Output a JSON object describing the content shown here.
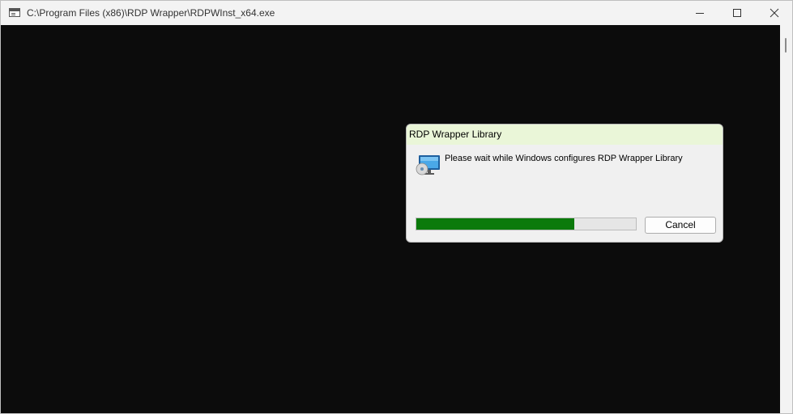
{
  "window": {
    "title": "C:\\Program Files (x86)\\RDP Wrapper\\RDPWInst_x64.exe",
    "controls": {
      "minimize_icon": "minimize-icon",
      "maximize_icon": "maximize-icon",
      "close_icon": "close-icon"
    }
  },
  "dialog": {
    "title": "RDP Wrapper Library",
    "message": "Please wait while Windows configures RDP Wrapper Library",
    "icon": "setup-computer-icon",
    "progress": 0.72,
    "cancel_label": "Cancel"
  },
  "colors": {
    "console_background": "#0c0c0c",
    "dialog_title_background": "#eaf6d8",
    "progress_fill": "#0b7a0b"
  }
}
